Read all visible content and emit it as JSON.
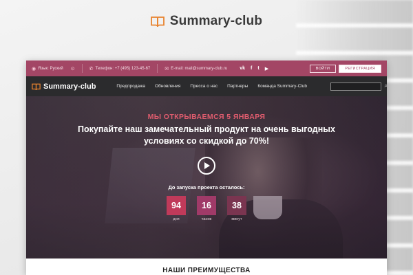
{
  "brand": {
    "name": "Summary-club",
    "accent": "#e8832f"
  },
  "topbar": {
    "language_label": "Язык: Руский",
    "phone_label": "Телефон: +7 (495) 123-45-67",
    "email_label": "E-mail: mail@summary-club.ru",
    "social": [
      "vk",
      "f",
      "t",
      "yt"
    ],
    "login_label": "ВОЙТИ",
    "register_label": "РЕГИСТРАЦИЯ",
    "bg_color": "#a34665"
  },
  "nav": {
    "logo_text": "Summary-club",
    "links": [
      "Предпродажа",
      "Обновления",
      "Пресса о нас",
      "Партнеры",
      "Команда Summary-Club"
    ],
    "search_placeholder": ""
  },
  "hero": {
    "kicker": "МЫ ОТКРЫВАЕМСЯ 5 ЯНВАРЯ",
    "title_line1": "Покупайте наш замечательный продукт на очень выгодных",
    "title_line2": "условиях со скидкой до 70%!",
    "countdown_label": "До запуска проекта осталось:",
    "countdown": [
      {
        "value": "94",
        "unit": "дня",
        "color": "#c03a5a"
      },
      {
        "value": "16",
        "unit": "часов",
        "color": "#a03a68"
      },
      {
        "value": "38",
        "unit": "минут",
        "color": "#7a3550"
      }
    ],
    "slides": 3,
    "active_slide": 1
  },
  "advantages": {
    "title": "НАШИ ПРЕИМУЩЕСТВА"
  }
}
